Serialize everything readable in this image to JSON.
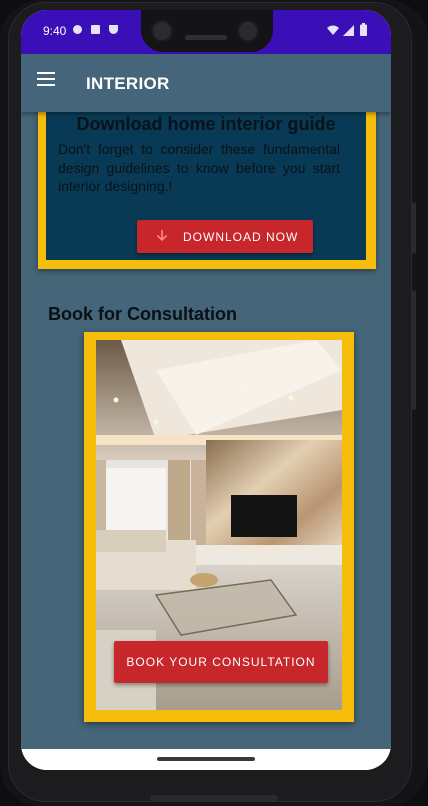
{
  "status_bar": {
    "time": "9:40",
    "left_icons": [
      "do-not-disturb-icon",
      "sim-card-icon",
      "shield-icon"
    ],
    "right_icons": [
      "wifi-icon",
      "cellular-icon",
      "battery-icon"
    ],
    "color": "#3b0fb8"
  },
  "app_bar": {
    "title": "INTERIOR",
    "menu_icon": "hamburger-menu-icon",
    "color": "#45657a"
  },
  "guide_card": {
    "title": "Download home interior guide",
    "body": "Don't forget to consider these fundamental design guidelines to know before you start  interior designing.!",
    "button_label": "DOWNLOAD NOW",
    "button_icon": "download-arrow-icon"
  },
  "consultation": {
    "section_title": "Book for Consultation",
    "button_label": "BOOK YOUR CONSULTATION"
  },
  "colors": {
    "accent_yellow": "#f6bd0b",
    "button_red": "#c7262a",
    "card_navy": "#083a55",
    "background": "#456578"
  }
}
